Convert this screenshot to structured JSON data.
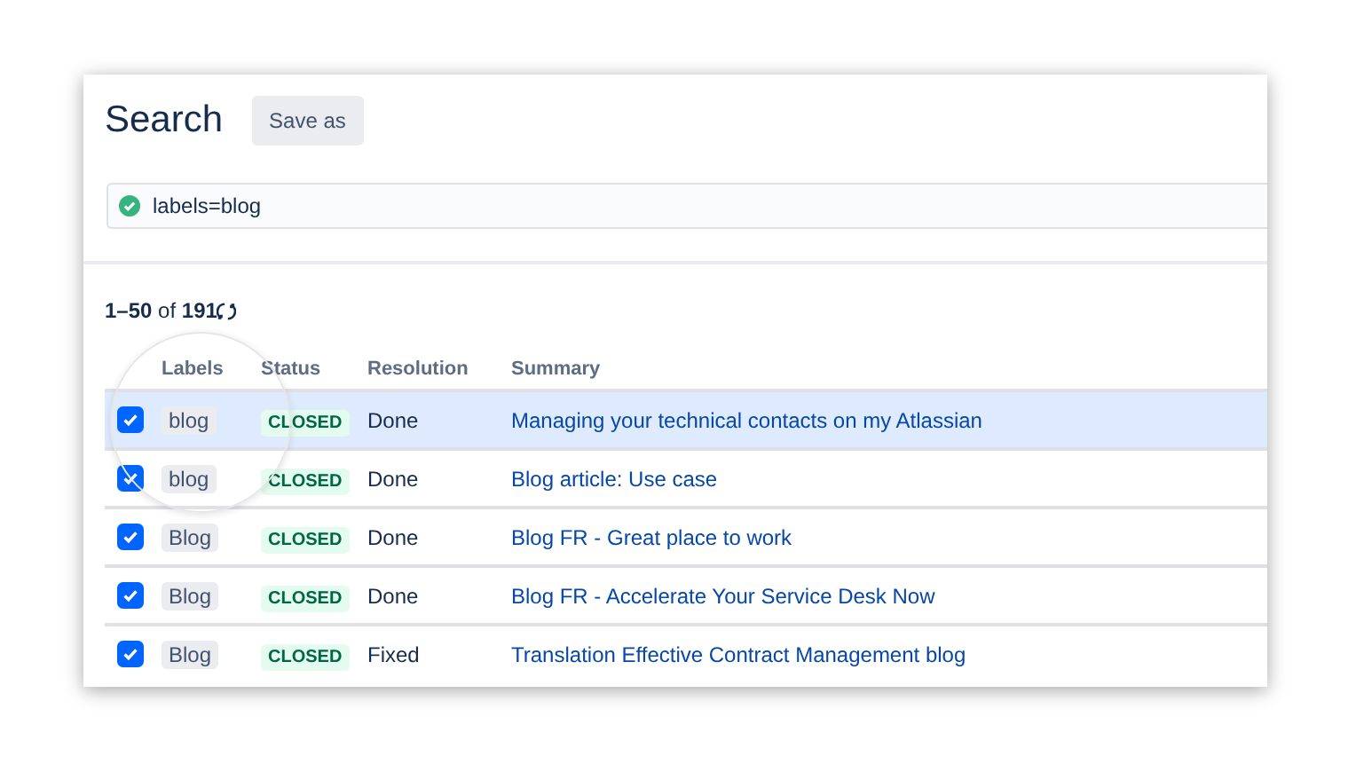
{
  "header": {
    "title": "Search",
    "save_button": "Save as"
  },
  "search": {
    "value": "labels=blog",
    "valid": true
  },
  "results": {
    "count": "**1–50** of **191**"
  },
  "table": {
    "columns": [
      "Labels",
      "Status",
      "Resolution",
      "Summary"
    ],
    "rows": [
      {
        "checked": true,
        "selected": true,
        "label": "blog",
        "status": "CLOSED",
        "resolution": "Done",
        "summary": "Managing your technical contacts on my Atlassian"
      },
      {
        "checked": true,
        "selected": false,
        "label": "blog",
        "status": "CLOSED",
        "resolution": "Done",
        "summary": "Blog article: Use case"
      },
      {
        "checked": true,
        "selected": false,
        "label": "Blog",
        "status": "CLOSED",
        "resolution": "Done",
        "summary": "Blog FR - Great place to work"
      },
      {
        "checked": true,
        "selected": false,
        "label": "Blog",
        "status": "CLOSED",
        "resolution": "Done",
        "summary": "Blog FR - Accelerate Your Service Desk Now"
      },
      {
        "checked": true,
        "selected": false,
        "label": "Blog",
        "status": "CLOSED",
        "resolution": "Fixed",
        "summary": "Translation Effective Contract Management blog"
      }
    ]
  }
}
